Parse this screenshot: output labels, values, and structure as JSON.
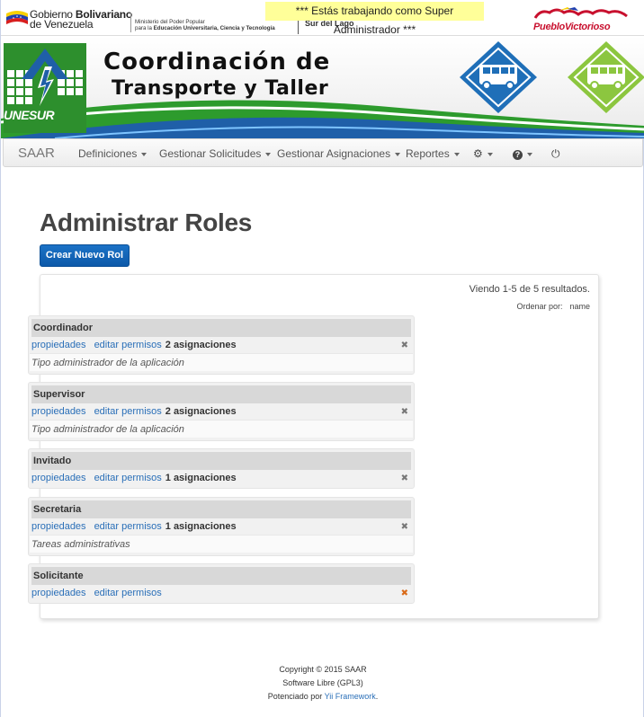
{
  "top": {
    "gov_line1": "Gobierno",
    "gov_line1_bold": "Bolivariano",
    "gov_line2": "de Venezuela",
    "ministry_line1": "Ministerio del Poder Popular",
    "ministry_line2_prefix": "para la",
    "ministry_line2_bold": "Educación Universitaria, Ciencia y Tecnología",
    "campus": "Sur del Lago",
    "admin_banner": "*** Estás trabajando como Super Administrador ***",
    "right_logo_text": "PuebloVictorioso"
  },
  "banner": {
    "logo_text": "UNESUR",
    "title_line1": "Coordinación de",
    "title_line2": "Transporte y Taller"
  },
  "navbar": {
    "brand": "SAAR",
    "items": [
      {
        "label": "Definiciones"
      },
      {
        "label": "Gestionar Solicitudes"
      },
      {
        "label": "Gestionar Asignaciones"
      },
      {
        "label": "Reportes"
      }
    ]
  },
  "page": {
    "title": "Administrar Roles",
    "create_button": "Crear Nuevo Rol",
    "summary": "Viendo 1-5 de 5 resultados.",
    "sort_label": "Ordenar por:",
    "sort_field": "name"
  },
  "roles": [
    {
      "name": "Coordinador",
      "prop": "propiedades",
      "perm": "editar permisos",
      "assign": "2 asignaciones",
      "desc": "Tipo administrador de la aplicación"
    },
    {
      "name": "Supervisor",
      "prop": "propiedades",
      "perm": "editar permisos",
      "assign": "2 asignaciones",
      "desc": "Tipo administrador de la aplicación"
    },
    {
      "name": "Invitado",
      "prop": "propiedades",
      "perm": "editar permisos",
      "assign": "1 asignaciones",
      "desc": ""
    },
    {
      "name": "Secretaria",
      "prop": "propiedades",
      "perm": "editar permisos",
      "assign": "1 asignaciones",
      "desc": "Tareas administrativas"
    },
    {
      "name": "Solicitante",
      "prop": "propiedades",
      "perm": "editar permisos",
      "assign": "",
      "desc": ""
    }
  ],
  "footer": {
    "line1": "Copyright © 2015 SAAR",
    "line2": "Software Libre (GPL3)",
    "line3_prefix": "Potenciado por",
    "line3_link": "Yii Framework",
    "line3_suffix": "."
  },
  "colors": {
    "primary": "#0c59a9",
    "link": "#2a6fb8",
    "banner_green": "#2d9b2d",
    "banner_blue": "#1f5fa8"
  }
}
